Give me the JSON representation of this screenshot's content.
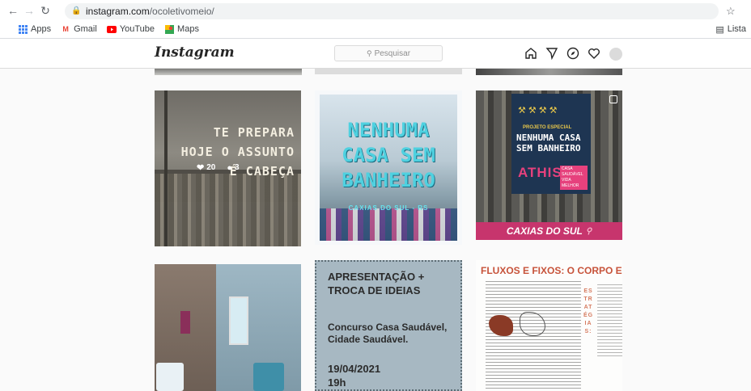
{
  "browser": {
    "url_domain": "instagram.com",
    "url_path": "/ocoletivomeio/",
    "bookmarks": [
      {
        "label": "Apps",
        "icon": "apps-grid-icon"
      },
      {
        "label": "Gmail",
        "icon": "gmail-icon"
      },
      {
        "label": "YouTube",
        "icon": "youtube-icon"
      },
      {
        "label": "Maps",
        "icon": "maps-icon"
      }
    ],
    "reading_list": "Lista"
  },
  "instagram": {
    "logo": "Instagram",
    "search_placeholder": "Pesquisar",
    "nav_icons": [
      "home-icon",
      "direct-icon",
      "explore-icon",
      "activity-heart-icon",
      "profile-avatar-icon"
    ]
  },
  "posts": {
    "p1": {
      "text_lines": [
        "TE PREPARA",
        "HOJE O ASSUNTO",
        "É CABEÇA"
      ],
      "likes": "20",
      "comments": "3"
    },
    "p2": {
      "text_lines": [
        "NENHUMA",
        "CASA SEM",
        "BANHEIRO"
      ],
      "subtitle": "CAXIAS DO SUL - RS"
    },
    "p3": {
      "tag": "PROJETO ESPECIAL",
      "headline": "NENHUMA CASA SEM BANHEIRO",
      "brand": "ATHIS",
      "brand_sub": "CASA SAUDÁVEL VIDA MELHOR",
      "footer": "CAXIAS DO SUL"
    },
    "p5": {
      "title": "APRESENTAÇÃO + TROCA DE IDEIAS",
      "body": "Concurso Casa Saudável, Cidade Saudável.",
      "date": "19/04/2021",
      "time": "19h"
    },
    "p6": {
      "title": "FLUXOS E FIXOS: O CORPO E A C",
      "vertical": "ESTRATÉGIAS:"
    }
  }
}
